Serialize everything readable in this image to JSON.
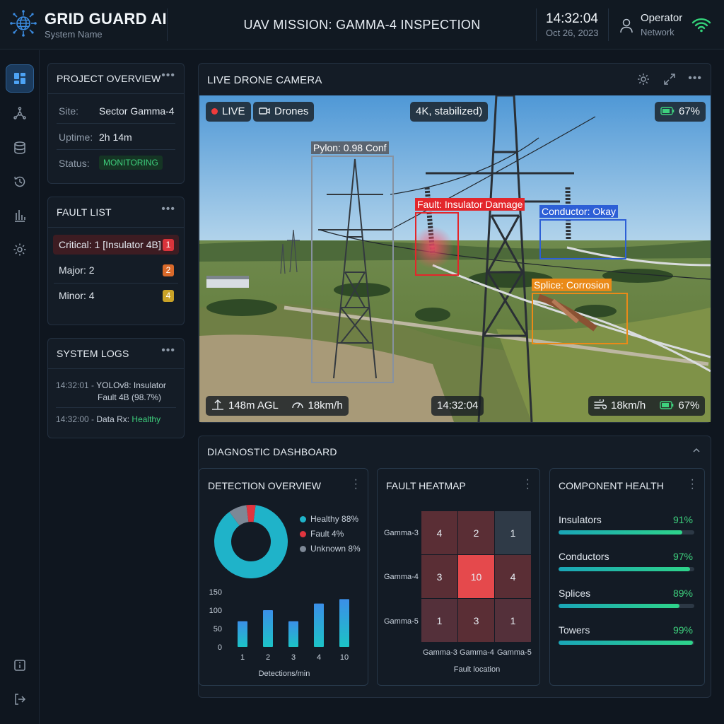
{
  "header": {
    "brand": "GRID GUARD AI",
    "brand_sub": "System Name",
    "mission": "UAV MISSION: GAMMA-4 INSPECTION",
    "time": "14:32:04",
    "date": "Oct 26, 2023",
    "user": "Operator",
    "network": "Network"
  },
  "sidebar": {
    "icons": [
      "dashboard-icon",
      "drone-icon",
      "database-icon",
      "history-icon",
      "analytics-icon",
      "settings-icon",
      "info-icon",
      "logout-icon"
    ]
  },
  "project": {
    "title": "PROJECT OVERVIEW",
    "site_label": "Site:",
    "site": "Sector Gamma-4",
    "uptime_label": "Uptime:",
    "uptime": "2h 14m",
    "status_label": "Status:",
    "status": "MONITORING"
  },
  "faults": {
    "title": "FAULT LIST",
    "items": [
      {
        "label": "Critical: 1 [Insulator 4B]",
        "count": "1",
        "color": "#d9343b"
      },
      {
        "label": "Major: 2",
        "count": "2",
        "color": "#d9692a"
      },
      {
        "label": "Minor: 4",
        "count": "4",
        "color": "#c9a227"
      }
    ]
  },
  "logs": {
    "title": "SYSTEM LOGS",
    "items": [
      {
        "ts": "14:32:01 -",
        "text": "YOLOv8: Insulator",
        "text2": "Fault 4B (98.7%)"
      },
      {
        "ts": "14:32:00 -",
        "text": "Data Rx:",
        "status": "Healthy"
      }
    ]
  },
  "camera": {
    "title": "LIVE DRONE CAMERA",
    "live": "LIVE",
    "drones": "Drones",
    "quality": "4K, stabilized)",
    "battery": "67%",
    "altitude": "148m AGL",
    "speed": "18km/h",
    "timestamp": "14:32:04",
    "wind_speed": "18km/h",
    "battery2": "67%",
    "detections": [
      {
        "label": "Pylon: 0.98 Conf",
        "color": "#8792a0"
      },
      {
        "label": "Fault: Insulator Damage",
        "color": "#e3262b"
      },
      {
        "label": "Conductor: Okay",
        "color": "#2d5fd6"
      },
      {
        "label": "Splice: Corrosion",
        "color": "#ea8a18"
      }
    ]
  },
  "diagnostic": {
    "title": "DIAGNOSTIC DASHBOARD",
    "detection": {
      "title": "DETECTION OVERVIEW",
      "legend": [
        {
          "label": "Healthy 88%",
          "color": "#1fb3c9"
        },
        {
          "label": "Fault 4%",
          "color": "#e0353f"
        },
        {
          "label": "Unknown 8%",
          "color": "#7d8896"
        }
      ],
      "xlabel": "Detections/min"
    },
    "heatmap": {
      "title": "FAULT HEATMAP",
      "rows": [
        "Gamma-3",
        "Gamma-4",
        "Gamma-5"
      ],
      "cols": [
        "Gamma-3",
        "Gamma-4",
        "Gamma-5"
      ],
      "xlabel": "Fault location"
    },
    "health": {
      "title": "COMPONENT HEALTH",
      "items": [
        {
          "name": "Insulators",
          "pct": "91%",
          "value": 91
        },
        {
          "name": "Conductors",
          "pct": "97%",
          "value": 97
        },
        {
          "name": "Splices",
          "pct": "89%",
          "value": 89
        },
        {
          "name": "Towers",
          "pct": "99%",
          "value": 99
        }
      ]
    }
  },
  "chart_data": [
    {
      "type": "pie",
      "title": "",
      "categories": [
        "Healthy",
        "Fault",
        "Unknown"
      ],
      "values": [
        88,
        4,
        8
      ]
    },
    {
      "type": "bar",
      "title": "",
      "xlabel": "Detections/min",
      "ylabel": "",
      "categories": [
        "1",
        "2",
        "3",
        "4",
        "10"
      ],
      "values": [
        70,
        100,
        70,
        118,
        130
      ],
      "yticks": [
        0,
        50,
        100,
        150
      ],
      "ylim": [
        0,
        150
      ]
    },
    {
      "type": "heatmap",
      "title": "",
      "xlabel": "Fault location",
      "x": [
        "Gamma-3",
        "Gamma-4",
        "Gamma-5"
      ],
      "y": [
        "Gamma-3",
        "Gamma-4",
        "Gamma-5"
      ],
      "values": [
        [
          4,
          2,
          1
        ],
        [
          3,
          10,
          4
        ],
        [
          1,
          3,
          1
        ]
      ]
    }
  ]
}
